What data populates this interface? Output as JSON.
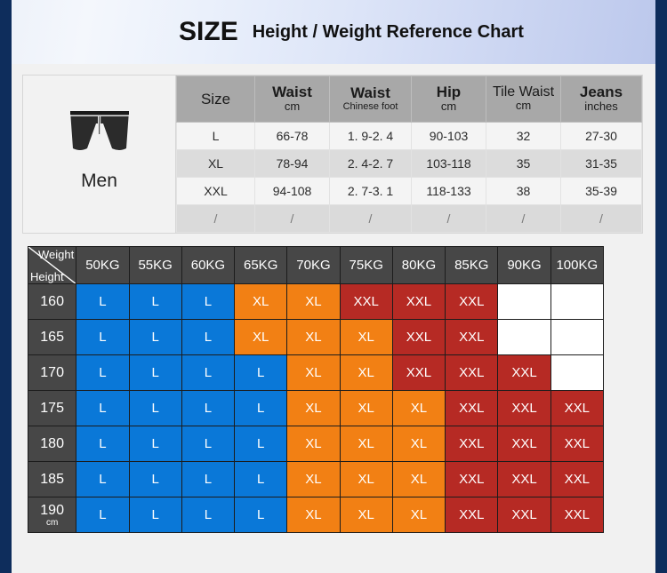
{
  "banner": {
    "size_word": "SIZE",
    "subtitle": "Height / Weight Reference Chart"
  },
  "men_panel": {
    "icon": "shorts-icon",
    "label": "Men"
  },
  "size_table": {
    "headers": [
      {
        "main": "Size",
        "unit": ""
      },
      {
        "main": "Waist",
        "unit": "cm"
      },
      {
        "main": "Waist",
        "unit": "Chinese foot"
      },
      {
        "main": "Hip",
        "unit": "cm"
      },
      {
        "main": "Tile Waist",
        "unit": "cm"
      },
      {
        "main": "Jeans",
        "unit": "inches"
      }
    ],
    "rows": [
      [
        "L",
        "66-78",
        "1. 9-2. 4",
        "90-103",
        "32",
        "27-30"
      ],
      [
        "XL",
        "78-94",
        "2. 4-2. 7",
        "103-118",
        "35",
        "31-35"
      ],
      [
        "XXL",
        "94-108",
        "2. 7-3. 1",
        "118-133",
        "38",
        "35-39"
      ],
      [
        "/",
        "/",
        "/",
        "/",
        "/",
        "/"
      ]
    ]
  },
  "matrix": {
    "corner": {
      "weight_label": "Weight",
      "height_label": "Height"
    },
    "weights": [
      "50KG",
      "55KG",
      "60KG",
      "65KG",
      "70KG",
      "75KG",
      "80KG",
      "85KG",
      "90KG",
      "100KG"
    ],
    "heights": [
      "160",
      "165",
      "170",
      "175",
      "180",
      "185",
      "190"
    ],
    "height_unit": "cm",
    "rows": [
      {
        "height": "160",
        "cells": [
          "L",
          "L",
          "L",
          "XL",
          "XL",
          "XXL",
          "XXL",
          "XXL",
          "",
          ""
        ]
      },
      {
        "height": "165",
        "cells": [
          "L",
          "L",
          "L",
          "XL",
          "XL",
          "XL",
          "XXL",
          "XXL",
          "",
          ""
        ]
      },
      {
        "height": "170",
        "cells": [
          "L",
          "L",
          "L",
          "L",
          "XL",
          "XL",
          "XXL",
          "XXL",
          "XXL",
          ""
        ]
      },
      {
        "height": "175",
        "cells": [
          "L",
          "L",
          "L",
          "L",
          "XL",
          "XL",
          "XL",
          "XXL",
          "XXL",
          "XXL"
        ]
      },
      {
        "height": "180",
        "cells": [
          "L",
          "L",
          "L",
          "L",
          "XL",
          "XL",
          "XL",
          "XXL",
          "XXL",
          "XXL"
        ]
      },
      {
        "height": "185",
        "cells": [
          "L",
          "L",
          "L",
          "L",
          "XL",
          "XL",
          "XL",
          "XXL",
          "XXL",
          "XXL"
        ]
      },
      {
        "height": "190",
        "cells": [
          "L",
          "L",
          "L",
          "L",
          "XL",
          "XL",
          "XL",
          "XXL",
          "XXL",
          "XXL"
        ]
      }
    ]
  },
  "colors": {
    "size_L": "#0a78d8",
    "size_XL": "#f28014",
    "size_XXL": "#b62a24",
    "header_dark": "#474747",
    "header_gray": "#a8a8a8",
    "frame_navy": "#0e2d5c"
  }
}
